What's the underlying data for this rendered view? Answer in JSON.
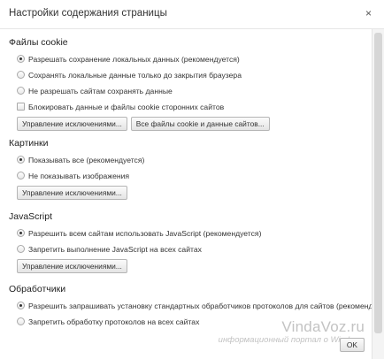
{
  "dialog": {
    "title": "Настройки содержания страницы",
    "close_glyph": "×"
  },
  "cookies": {
    "title": "Файлы cookie",
    "options": [
      {
        "label": "Разрешать сохранение локальных данных (рекомендуется)",
        "type": "radio",
        "checked": true
      },
      {
        "label": "Сохранять локальные данные только до закрытия браузера",
        "type": "radio",
        "checked": false
      },
      {
        "label": "Не разрешать сайтам сохранять данные",
        "type": "radio",
        "checked": false
      },
      {
        "label": "Блокировать данные и файлы cookie сторонних сайтов",
        "type": "checkbox",
        "checked": false
      }
    ],
    "buttons": {
      "manage_exceptions": "Управление исключениями...",
      "all_cookies": "Все файлы cookie и данные сайтов..."
    }
  },
  "images": {
    "title": "Картинки",
    "options": [
      {
        "label": "Показывать все (рекомендуется)",
        "type": "radio",
        "checked": true
      },
      {
        "label": "Не показывать изображения",
        "type": "radio",
        "checked": false
      }
    ],
    "buttons": {
      "manage_exceptions": "Управление исключениями..."
    }
  },
  "javascript": {
    "title": "JavaScript",
    "options": [
      {
        "label": "Разрешить всем сайтам использовать JavaScript (рекомендуется)",
        "type": "radio",
        "checked": true
      },
      {
        "label": "Запретить выполнение JavaScript на всех сайтах",
        "type": "radio",
        "checked": false
      }
    ],
    "buttons": {
      "manage_exceptions": "Управление исключениями..."
    }
  },
  "handlers": {
    "title": "Обработчики",
    "options": [
      {
        "label": "Разрешить запрашивать установку стандартных обработчиков протоколов для сайтов (рекомендуется)",
        "type": "radio",
        "checked": true
      },
      {
        "label": "Запретить обработку протоколов на всех сайтах",
        "type": "radio",
        "checked": false
      }
    ]
  },
  "watermark": {
    "brand": "VindaVoz.ru",
    "subtitle": "информационный портал о Windows"
  },
  "footer": {
    "ok_label": "OK"
  }
}
